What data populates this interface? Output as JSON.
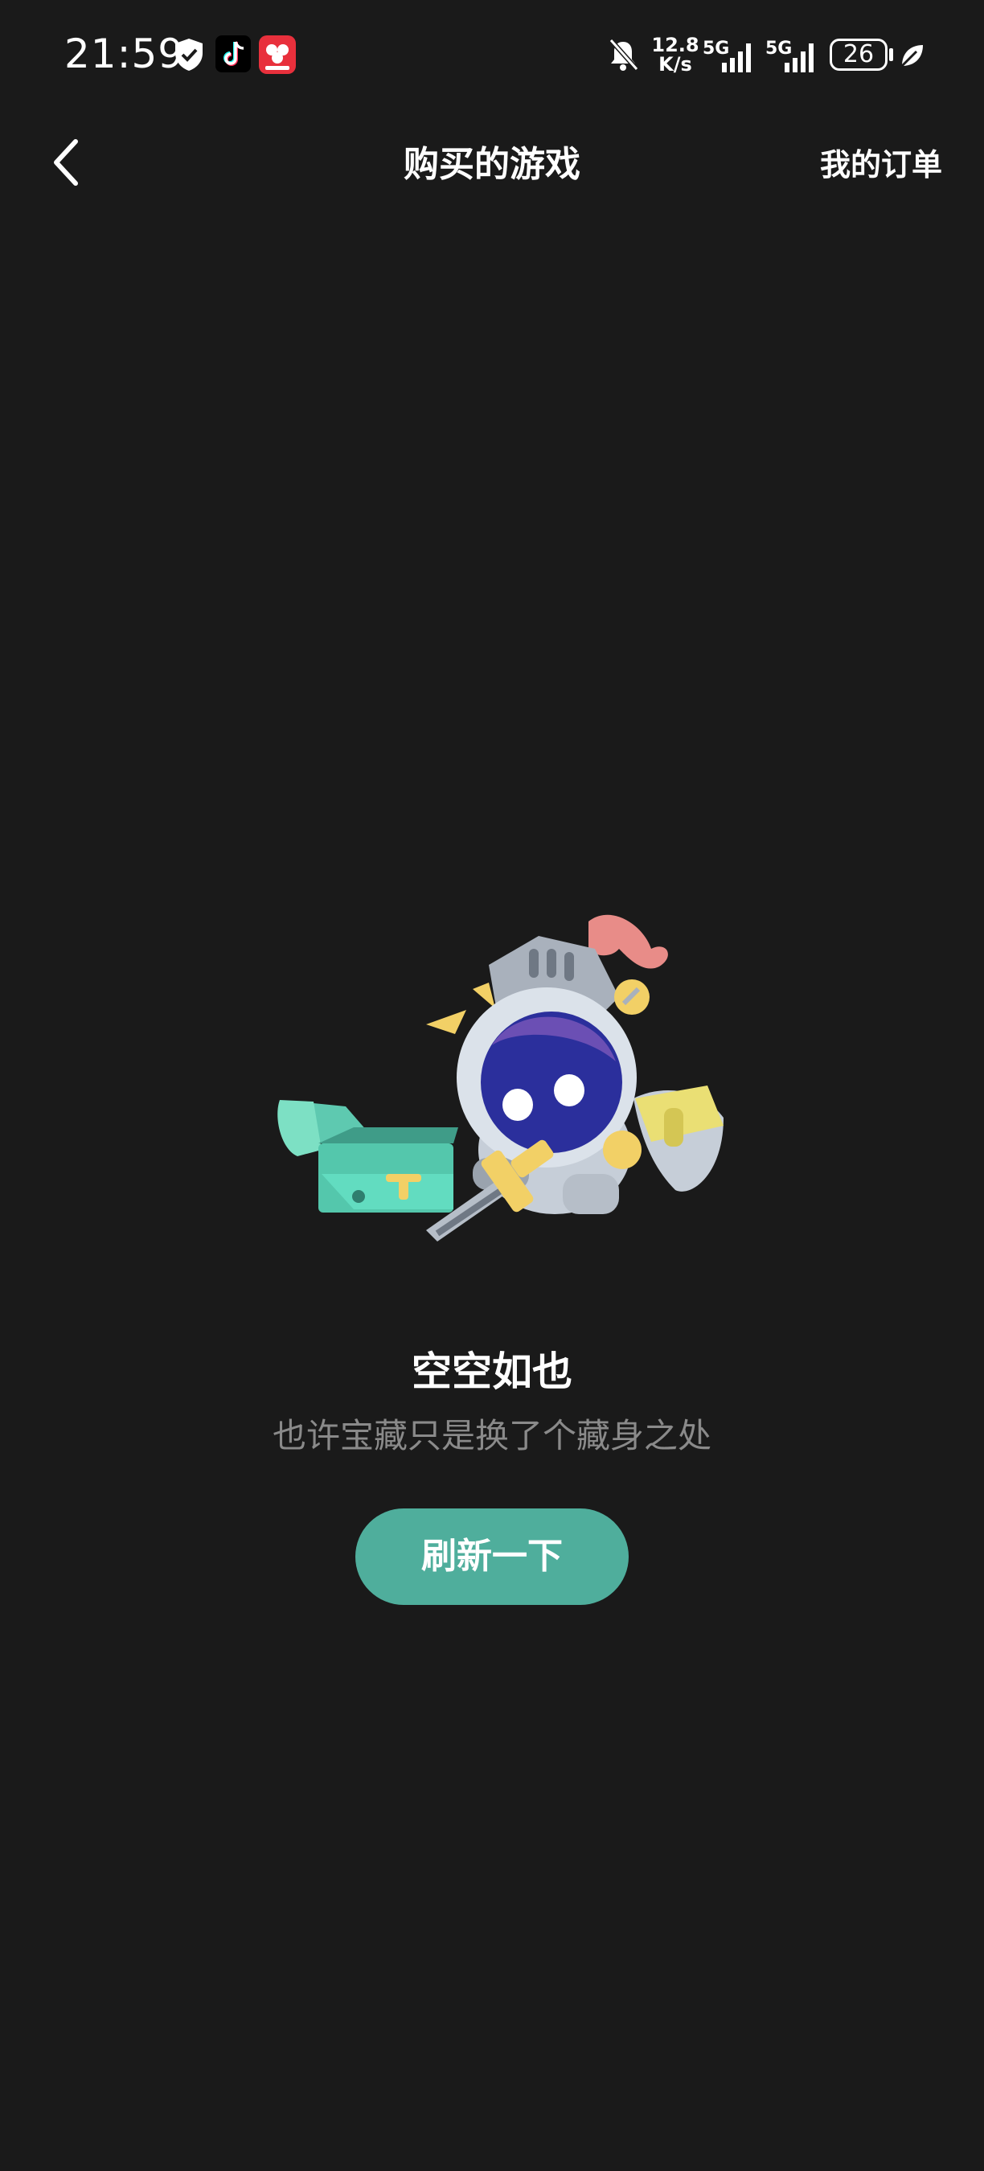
{
  "status_bar": {
    "time": "21:59",
    "net_speed_value": "12.8",
    "net_speed_unit": "K/s",
    "signal_1_label": "5G",
    "signal_2_label": "5G",
    "battery_level": "26",
    "icons": [
      "shield-check-icon",
      "tiktok-icon",
      "app-badge-icon",
      "bell-mute-icon",
      "signal-icon",
      "battery-icon",
      "leaf-icon"
    ]
  },
  "header": {
    "title": "购买的游戏",
    "right_link": "我的订单",
    "back_icon": "chevron-left-icon"
  },
  "empty_state": {
    "title": "空空如也",
    "subtitle": "也许宝藏只是换了个藏身之处",
    "button_label": "刷新一下",
    "illustration": "knight-with-treasure-chest"
  },
  "colors": {
    "background": "#1a1a1a",
    "accent": "#4fae9c",
    "subtitle_text": "#8a8a8a"
  }
}
